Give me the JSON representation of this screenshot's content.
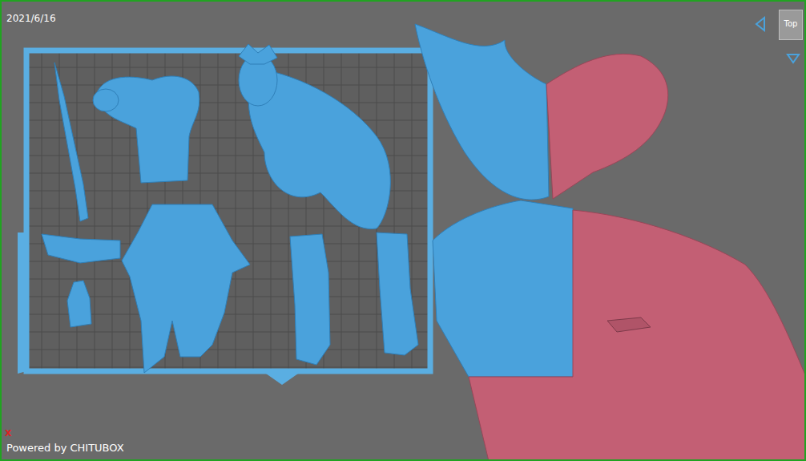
{
  "viewport": {
    "date": "2021/6/16",
    "view_cube": {
      "label": "Top"
    },
    "axis_label": "X",
    "footer": "Powered by CHITUBOX"
  },
  "models": [
    {
      "kind": "sword",
      "outside": false
    },
    {
      "kind": "torso",
      "outside": false
    },
    {
      "kind": "legs",
      "outside": false
    },
    {
      "kind": "head",
      "outside": false
    },
    {
      "kind": "boots",
      "outside": false
    },
    {
      "kind": "arm",
      "outside": false
    },
    {
      "kind": "hand",
      "outside": false
    },
    {
      "kind": "cape",
      "outside": true
    },
    {
      "kind": "base",
      "outside": true
    }
  ]
}
